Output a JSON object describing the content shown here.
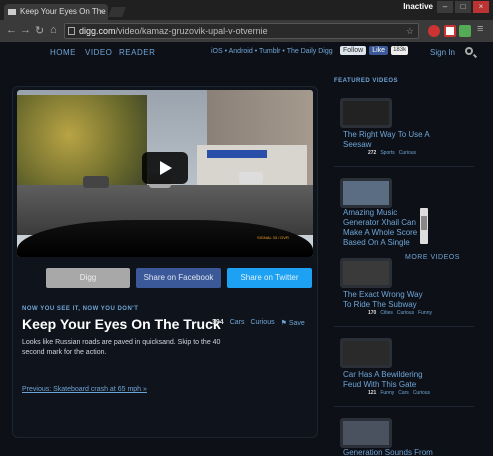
{
  "browser": {
    "tab_title": "Keep Your Eyes On The Tr",
    "tab_close": "×",
    "window_state": "Inactive",
    "win_min": "–",
    "win_max": "□",
    "win_close": "×",
    "url_host": "digg.com",
    "url_path": "/video/kamaz-gruzovik-upal-v-otvernie"
  },
  "nav": {
    "home": "HOME",
    "video": "VIDEO",
    "reader": "READER",
    "platforms": "iOS • Android • Tumblr • The Daily Digg",
    "follow": "Follow",
    "like": "Like",
    "like_count": "183k",
    "signin": "Sign In"
  },
  "article": {
    "kicker": "NOW YOU SEE IT, NOW YOU DON'T",
    "title": "Keep Your Eyes On The Truck",
    "description": "Looks like Russian roads are paved in quicksand. Skip to the 40 second mark for the action.",
    "count": "394",
    "tag1": "Cars",
    "tag2": "Curious",
    "save": "Save",
    "previous": "Previous: Skateboard crash at 65 mph »",
    "share_digg": "Digg",
    "share_facebook": "Share on Facebook",
    "share_twitter": "Share on Twitter",
    "video_stamp": "SIGNAL 33 / DVR"
  },
  "sidebar": {
    "heading": "FEATURED VIDEOS",
    "more": "MORE VIDEOS",
    "items": [
      {
        "title": "The Right Way To Use A Seesaw",
        "count": "272",
        "tag1": "Sports",
        "tag2": "Curious"
      },
      {
        "title": "Amazing Music Generator Xhail Can Make A Whole Score Based On A Single",
        "count": "",
        "tag1": "",
        "tag2": ""
      },
      {
        "title": "The Exact Wrong Way To Ride The Subway",
        "count": "170",
        "tag1": "Cities",
        "tag2": "Curious",
        "tag3": "Funny"
      },
      {
        "title": "Car Has A Bewildering Feud With This Gate",
        "count": "121",
        "tag1": "Funny",
        "tag2": "Cars",
        "tag3": "Curious"
      },
      {
        "title": "Generation Sounds From",
        "count": "",
        "tag1": "",
        "tag2": ""
      }
    ]
  },
  "colors": {
    "link": "#6fa5d6",
    "facebook": "#3b5998",
    "twitter": "#1da1f2",
    "digg_btn": "#a8a8a8"
  }
}
